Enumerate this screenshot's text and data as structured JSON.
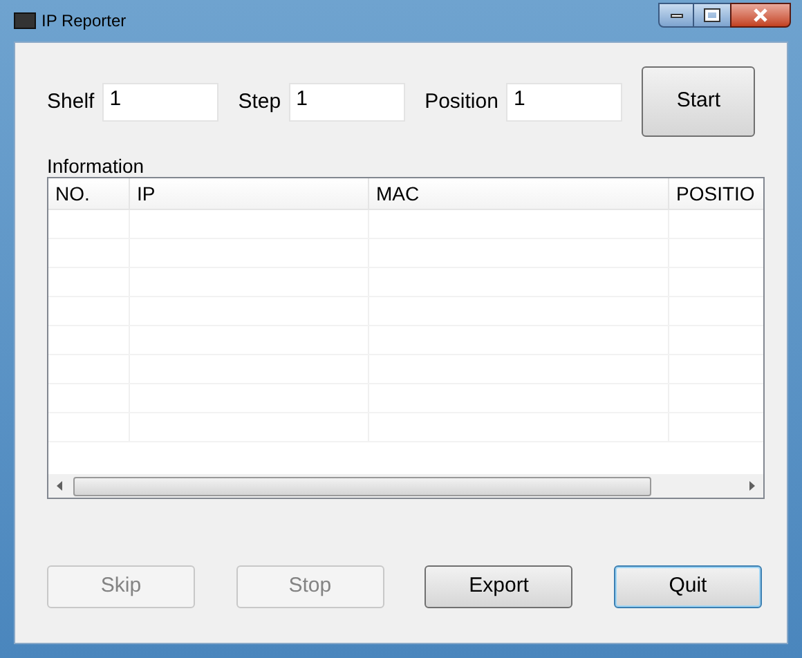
{
  "window": {
    "title": "IP Reporter"
  },
  "fields": [
    {
      "label": "Shelf",
      "value": "1"
    },
    {
      "label": "Step",
      "value": "1"
    },
    {
      "label": "Position",
      "value": "1"
    }
  ],
  "start_button": {
    "label": "Start",
    "disabled": false
  },
  "information": {
    "label": "Information",
    "columns": [
      "NO.",
      "IP",
      "MAC",
      "POSITIO"
    ]
  },
  "buttons": [
    {
      "label": "Skip",
      "disabled": true,
      "focused": false
    },
    {
      "label": "Stop",
      "disabled": true,
      "focused": false
    },
    {
      "label": "Export",
      "disabled": false,
      "focused": false
    },
    {
      "label": "Quit",
      "disabled": false,
      "focused": true
    }
  ]
}
